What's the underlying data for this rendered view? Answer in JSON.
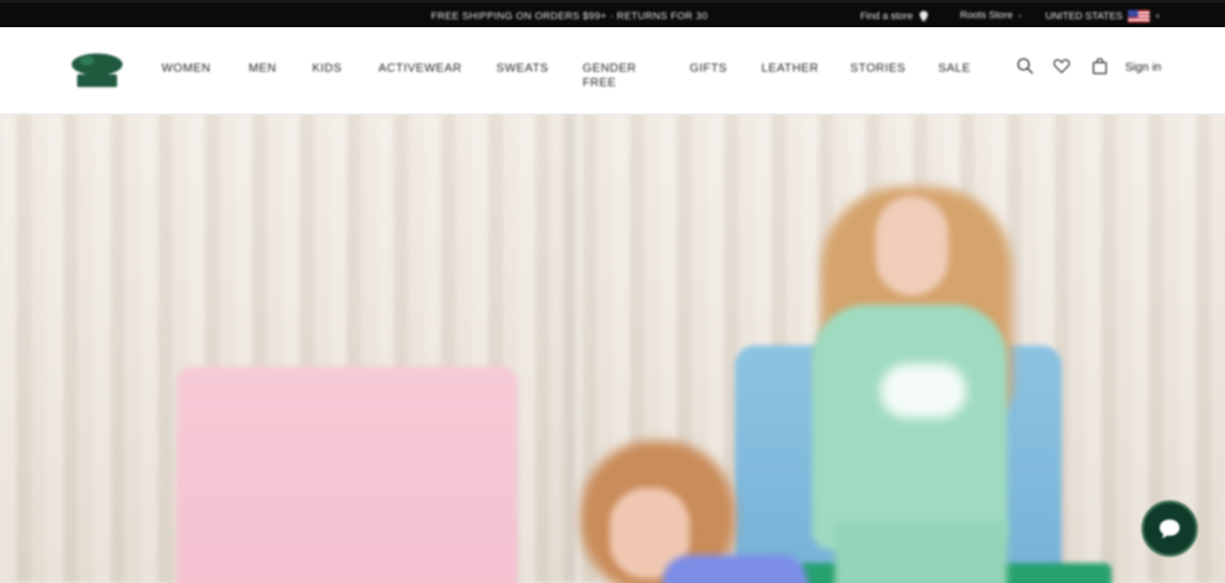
{
  "topbar": {
    "promo": "FREE SHIPPING ON ORDERS $99+ · RETURNS FOR 30",
    "find_store": "Find a store",
    "store_icon": "map-pin-icon",
    "region": "Roots Store",
    "region_caret": "›",
    "country": "UNITED STATES",
    "country_flag": "us-flag-icon",
    "country_caret": "˅"
  },
  "header": {
    "logo": "roots-beaver-logo",
    "nav": [
      {
        "label": "WOMEN"
      },
      {
        "label": "MEN"
      },
      {
        "label": "KIDS"
      },
      {
        "label": "ACTIVEWEAR"
      },
      {
        "label": "SWEATS"
      },
      {
        "label": "GENDER FREE"
      },
      {
        "label": "GIFTS"
      },
      {
        "label": "LEATHER"
      },
      {
        "label": "STORIES"
      },
      {
        "label": "SALE"
      }
    ],
    "icons": {
      "search": "search-icon",
      "wishlist": "heart-icon",
      "bag": "shopping-bag-icon"
    },
    "signin": "Sign in"
  },
  "hero": {
    "image": "kids-hoodie-lifestyle-photo"
  },
  "chat": {
    "icon": "chat-bubble-icon"
  },
  "colors": {
    "topbar_bg": "#0b0b0b",
    "brand_green": "#0e3b2a",
    "hoodie_mint": "#9fdbc0",
    "pink_chair": "#f6cad6",
    "blue_chair": "#8cc3e2"
  }
}
